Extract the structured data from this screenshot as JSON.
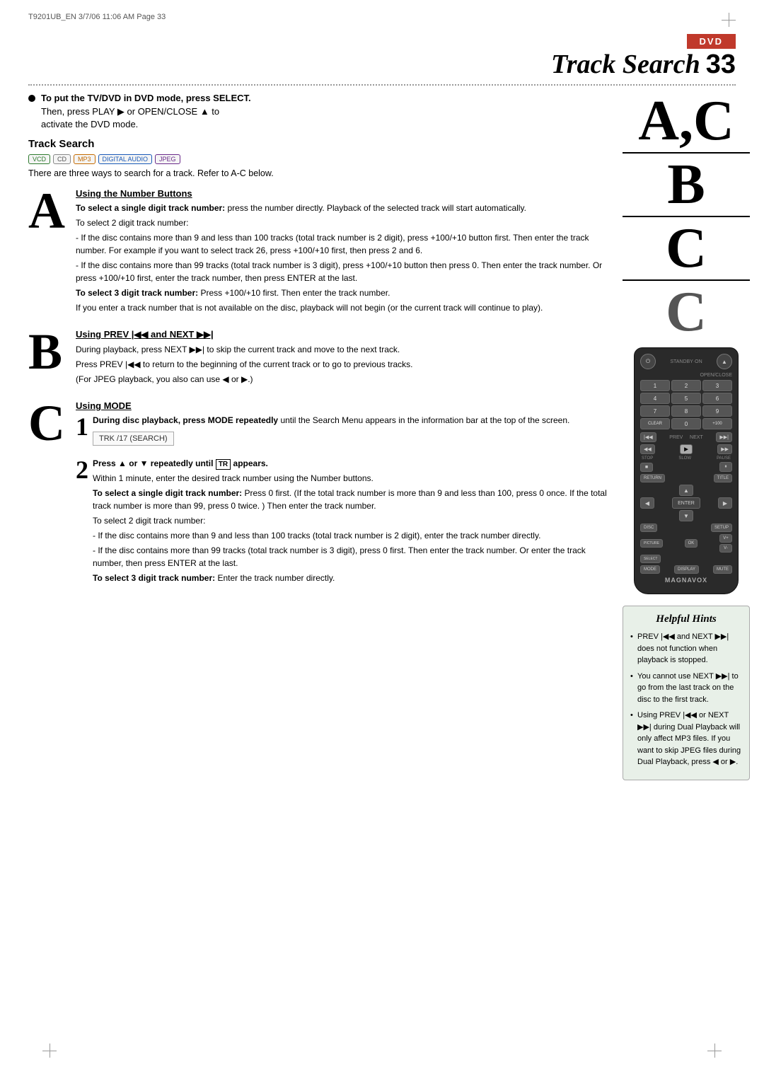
{
  "header": {
    "meta": "T9201UB_EN  3/7/06  11:06 AM  Page 33"
  },
  "dvd_label": "DVD",
  "title": "Track Search",
  "page_number": "33",
  "dotted_line": true,
  "intro": {
    "bullet1_bold": "To put the TV/DVD in DVD mode, press SELECT.",
    "bullet1_indent1": "Then, press PLAY ▶ or OPEN/CLOSE ▲ to",
    "bullet1_indent2": "activate the DVD mode."
  },
  "track_search": {
    "heading": "Track Search",
    "formats": [
      "VCD",
      "CD",
      "MP3",
      "DIGITAL AUDIO",
      "JPEG"
    ],
    "intro_text": "There are three ways to search for a track. Refer to A-C below."
  },
  "section_a": {
    "letter": "A",
    "title": "Using the Number Buttons",
    "para1_bold": "To select a single digit track number:",
    "para1_text": " press the number directly. Playback of the selected track will start automatically.",
    "para2_bold": "To select 2 digit track number:",
    "para2_bullets": [
      "- If the disc contains more than 9 and less than 100 tracks (total track number is 2 digit), press +100/+10 button first. Then enter the track number. For example if you want to select track 26, press +100/+10 first, then press 2 and 6.",
      "- If the disc contains more than 99 tracks (total track number is 3 digit), press +100/+10 button then press 0. Then enter the track number. Or press +100/+10 first, enter the track number, then press ENTER at the last."
    ],
    "para3_bold": "To select 3 digit track number:",
    "para3_text": " Press +100/+10 first. Then enter the track number.",
    "para4": "If you enter a track number that is not available on the disc, playback will not begin (or the current track will continue to play)."
  },
  "section_b": {
    "letter": "B",
    "title": "Using PREV |◀◀ and NEXT ▶▶|",
    "para1_bold": "During playback, press NEXT ▶▶| to skip the current track and move to the next track.",
    "para2_bold": "Press PREV |◀◀ to return to the beginning of the current track or to go to previous tracks.",
    "para3": "(For JPEG playback, you also can use ◀ or ▶.)"
  },
  "section_c": {
    "letter": "C",
    "title": "Using MODE",
    "step1_bold": "During disc playback, press MODE repeatedly",
    "step1_text": "until the Search Menu appears in the information bar at the top of the screen.",
    "search_menu_text": "TRK  /17 (SEARCH)",
    "step2_bold": "Press ▲ or ▼ repeatedly until",
    "step2_tr": "TR",
    "step2_bold2": "appears.",
    "step2_text": "Within 1 minute, enter the desired track number using the Number buttons.",
    "select_single_bold": "To select a single digit track number:",
    "select_single_text": " Press 0 first. (If the total track number is more than 9 and less than 100, press 0 once. If the total track number is more than 99, press 0 twice. ) Then enter the track number.",
    "select_2digit_bold": "To select 2 digit track number:",
    "select_2digit_bullets": [
      "- If the disc contains more than 9 and less than 100 tracks (total track number is 2 digit), enter the track number directly.",
      "- If the disc contains more than 99 tracks (total track number is 3 digit), press 0 first. Then enter the track number. Or enter the track number, then press ENTER at the last."
    ],
    "select_3digit_bold": "To select 3 digit track number:",
    "select_3digit_text": " Enter the track number directly."
  },
  "helpful_hints": {
    "title": "Helpful Hints",
    "items": [
      "PREV |◀◀ and NEXT ▶▶| does not function when playback is stopped.",
      "You cannot use NEXT ▶▶| to go from the last track on the disc to the first track.",
      "Using PREV |◀◀ or NEXT ▶▶| during Dual Playback will only affect MP3 files. If you want to skip JPEG files during Dual Playback, press ◀ or ▶."
    ]
  },
  "side_labels": {
    "ac": "A,C",
    "b": "B",
    "c1": "C",
    "c2": "C"
  },
  "remote": {
    "brand": "MAGNAVOX",
    "buttons": {
      "standby": "⏻",
      "open": "▲",
      "nums": [
        "1",
        "2",
        "3",
        "4",
        "5",
        "6",
        "7",
        "8",
        "9",
        "CLEAR",
        "0",
        "+100"
      ],
      "prev": "|◀◀",
      "next": "▶▶|",
      "rew": "◀◀",
      "play": "▶",
      "fwd": "▶▶",
      "stop": "■",
      "slow": "▷",
      "pause": "⏸",
      "return": "RETURN",
      "title": "TITLE",
      "left": "◀",
      "enter": "ENTER",
      "right": "▶",
      "disc": "DISC",
      "setup": "SETUP",
      "up": "▲",
      "down": "▼",
      "picture": "PIC",
      "ok": "OK",
      "vol_up": "V+",
      "vol_down": "V-",
      "select": "SELECT",
      "mode": "MODE",
      "display": "DISPLAY",
      "mute": "MUTE"
    }
  }
}
